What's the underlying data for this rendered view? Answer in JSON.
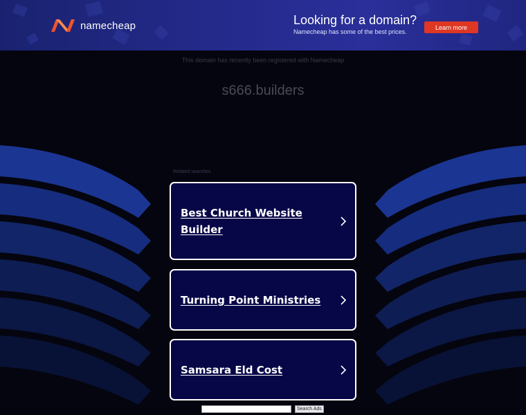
{
  "banner": {
    "logo_text": "namecheap",
    "headline": "Looking for a domain?",
    "subline": "Namecheap has some of the best prices.",
    "button_label": "Learn more"
  },
  "notice": "This domain has recently been registered with Namecheap",
  "domain_name": "s666.builders",
  "related_label": "Related searches",
  "results": [
    {
      "label": "Best Church Website Builder"
    },
    {
      "label": "Turning Point Ministries"
    },
    {
      "label": "Samsara Eld Cost"
    }
  ],
  "search": {
    "placeholder": "",
    "button_label": "Search Ads"
  },
  "colors": {
    "banner_bg": "#232a8a",
    "accent": "#de3723",
    "card_bg": "#070748",
    "page_bg": "#05050f"
  }
}
